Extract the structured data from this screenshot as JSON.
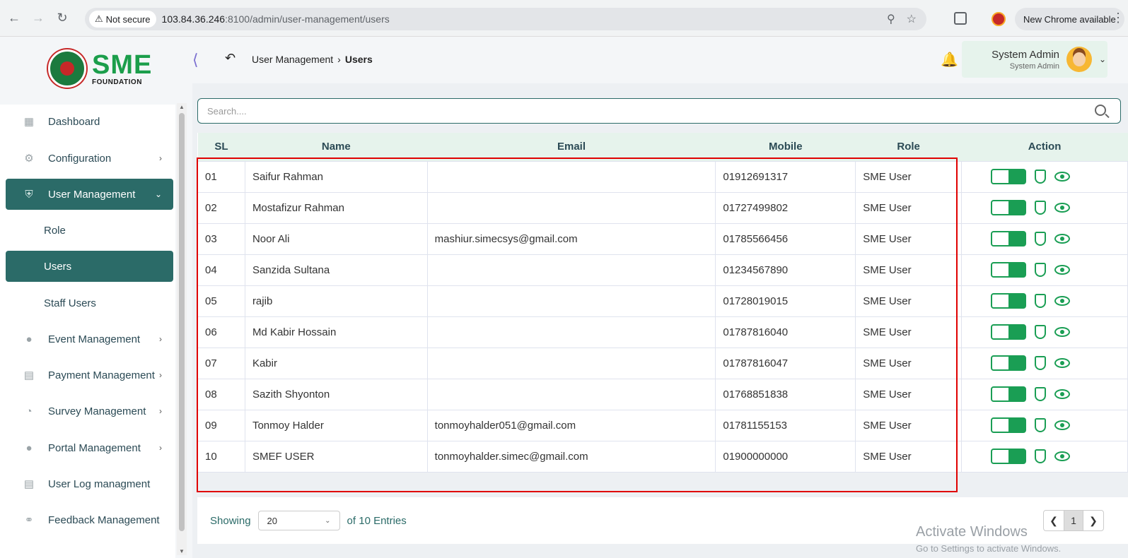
{
  "browser": {
    "not_secure_label": "Not secure",
    "url_host": "103.84.36.246",
    "url_rest": ":8100/admin/user-management/users",
    "update_label": "New Chrome available"
  },
  "logo": {
    "sme": "SME",
    "foundation": "FOUNDATION"
  },
  "breadcrumb": {
    "parent": "User Management",
    "current": "Users"
  },
  "user": {
    "name": "System Admin",
    "role": "System Admin"
  },
  "sidebar": {
    "items": [
      {
        "label": "Dashboard"
      },
      {
        "label": "Configuration"
      },
      {
        "label": "User Management"
      },
      {
        "label": "Role"
      },
      {
        "label": "Users"
      },
      {
        "label": "Staff Users"
      },
      {
        "label": "Event Management"
      },
      {
        "label": "Payment Management"
      },
      {
        "label": "Survey Management"
      },
      {
        "label": "Portal Management"
      },
      {
        "label": "User Log managment"
      },
      {
        "label": "Feedback Management"
      }
    ]
  },
  "search": {
    "placeholder": "Search...."
  },
  "table": {
    "headers": [
      "SL",
      "Name",
      "Email",
      "Mobile",
      "Role",
      "Action"
    ],
    "rows": [
      {
        "sl": "01",
        "name": "Saifur Rahman",
        "email": "",
        "mobile": "01912691317",
        "role": "SME User"
      },
      {
        "sl": "02",
        "name": "Mostafizur Rahman",
        "email": "",
        "mobile": "01727499802",
        "role": "SME User"
      },
      {
        "sl": "03",
        "name": "Noor Ali",
        "email": "mashiur.simecsys@gmail.com",
        "mobile": "01785566456",
        "role": "SME User"
      },
      {
        "sl": "04",
        "name": "Sanzida Sultana",
        "email": "",
        "mobile": "01234567890",
        "role": "SME User"
      },
      {
        "sl": "05",
        "name": "rajib",
        "email": "",
        "mobile": "01728019015",
        "role": "SME User"
      },
      {
        "sl": "06",
        "name": "Md Kabir Hossain",
        "email": "",
        "mobile": "01787816040",
        "role": "SME User"
      },
      {
        "sl": "07",
        "name": "Kabir",
        "email": "",
        "mobile": "01787816047",
        "role": "SME User"
      },
      {
        "sl": "08",
        "name": "Sazith Shyonton",
        "email": "",
        "mobile": "01768851838",
        "role": "SME User"
      },
      {
        "sl": "09",
        "name": "Tonmoy Halder",
        "email": "tonmoyhalder051@gmail.com",
        "mobile": "01781155153",
        "role": "SME User"
      },
      {
        "sl": "10",
        "name": "SMEF USER",
        "email": "tonmoyhalder.simec@gmail.com",
        "mobile": "01900000000",
        "role": "SME User"
      }
    ]
  },
  "footer": {
    "showing_label": "Showing",
    "page_size": "20",
    "entries_label": "of 10 Entries",
    "current_page": "1"
  },
  "watermark": {
    "line1": "Activate Windows",
    "line2": "Go to Settings to activate Windows."
  },
  "colors": {
    "primary": "#2b6b68",
    "accent_green": "#1a9e54",
    "highlight": "#e00000"
  }
}
